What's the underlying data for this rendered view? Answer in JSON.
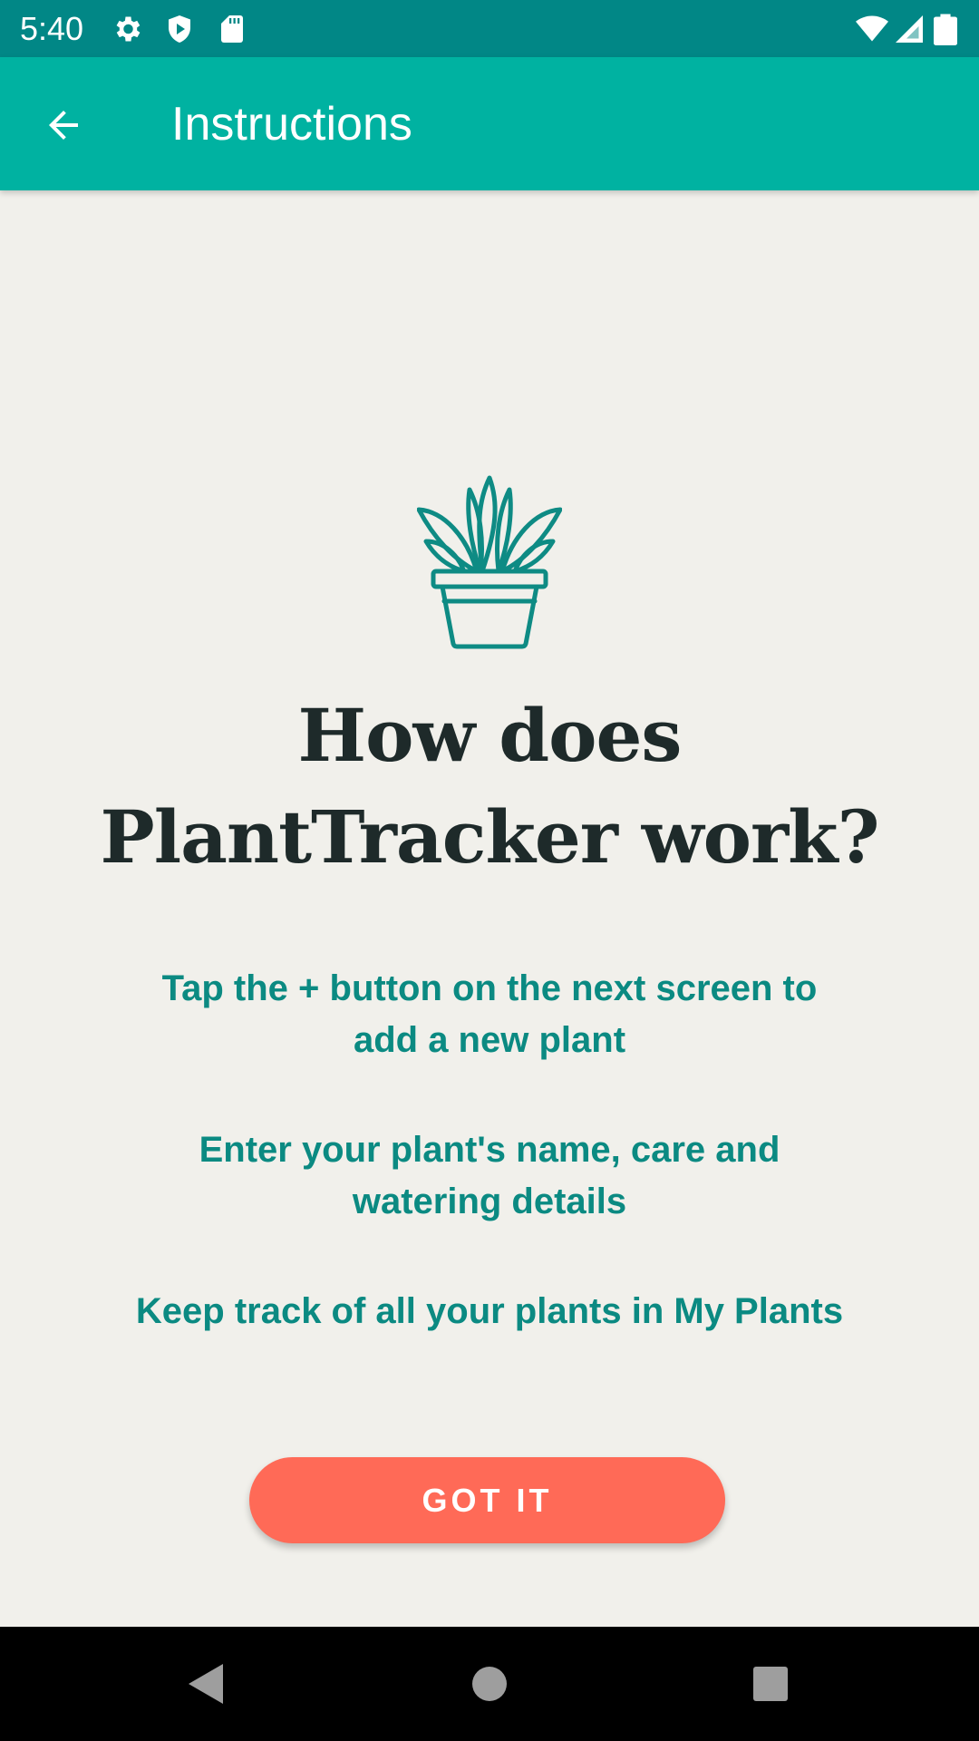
{
  "status_bar": {
    "time": "5:40",
    "left_icons": [
      "gear-icon",
      "shield-play-icon",
      "sd-card-icon"
    ],
    "right_icons": [
      "wifi-icon",
      "cell-signal-icon",
      "battery-icon"
    ]
  },
  "app_bar": {
    "title": "Instructions",
    "back_icon": "arrow-back-icon"
  },
  "content": {
    "illustration": "potted-plant-icon",
    "headline": "How does PlantTracker work?",
    "instructions": [
      "Tap the + button on the next screen to add a new plant",
      "Enter your plant's name, care and watering details",
      "Keep track of all your plants in My Plants"
    ],
    "button_label": "GOT IT"
  },
  "nav_bar": {
    "buttons": [
      "back-triangle-icon",
      "home-circle-icon",
      "recents-square-icon"
    ]
  },
  "colors": {
    "status_bar": "#018786",
    "app_bar": "#00b2a1",
    "background": "#f1f0eb",
    "headline": "#1e2a2a",
    "instruction_text": "#0b8a82",
    "button": "#ff6a57",
    "icon_teal": "#0e8b84"
  }
}
